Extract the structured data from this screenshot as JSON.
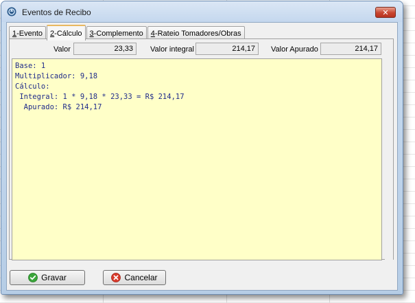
{
  "window": {
    "title": "Eventos de Recibo",
    "close_glyph": "✕"
  },
  "tabs": [
    {
      "key": "1",
      "label": "-Evento",
      "active": false
    },
    {
      "key": "2",
      "label": "-Cálculo",
      "active": true
    },
    {
      "key": "3",
      "label": "-Complemento",
      "active": false
    },
    {
      "key": "4",
      "label": "-Rateio Tomadores/Obras",
      "active": false
    }
  ],
  "fields": {
    "valor": {
      "label": "Valor",
      "value": "23,33"
    },
    "valor_integral": {
      "label": "Valor integral",
      "value": "214,17"
    },
    "valor_apurado": {
      "label": "Valor Apurado",
      "value": "214,17"
    }
  },
  "memo": {
    "lines": [
      "Base: 1",
      "Multiplicador: 9,18",
      "Cálculo:",
      " Integral: 1 * 9,18 * 23,33 = R$ 214,17",
      "  Apurado: R$ 214,17"
    ]
  },
  "buttons": {
    "save": {
      "label": "Gravar",
      "icon": "check-icon"
    },
    "cancel": {
      "label": "Cancelar",
      "icon": "cancel-icon"
    }
  },
  "colors": {
    "memo_bg": "#ffffc8",
    "memo_text": "#1f2b8a",
    "close_red": "#c8452f",
    "save_green": "#3aa53a",
    "cancel_red": "#d93a2b"
  }
}
